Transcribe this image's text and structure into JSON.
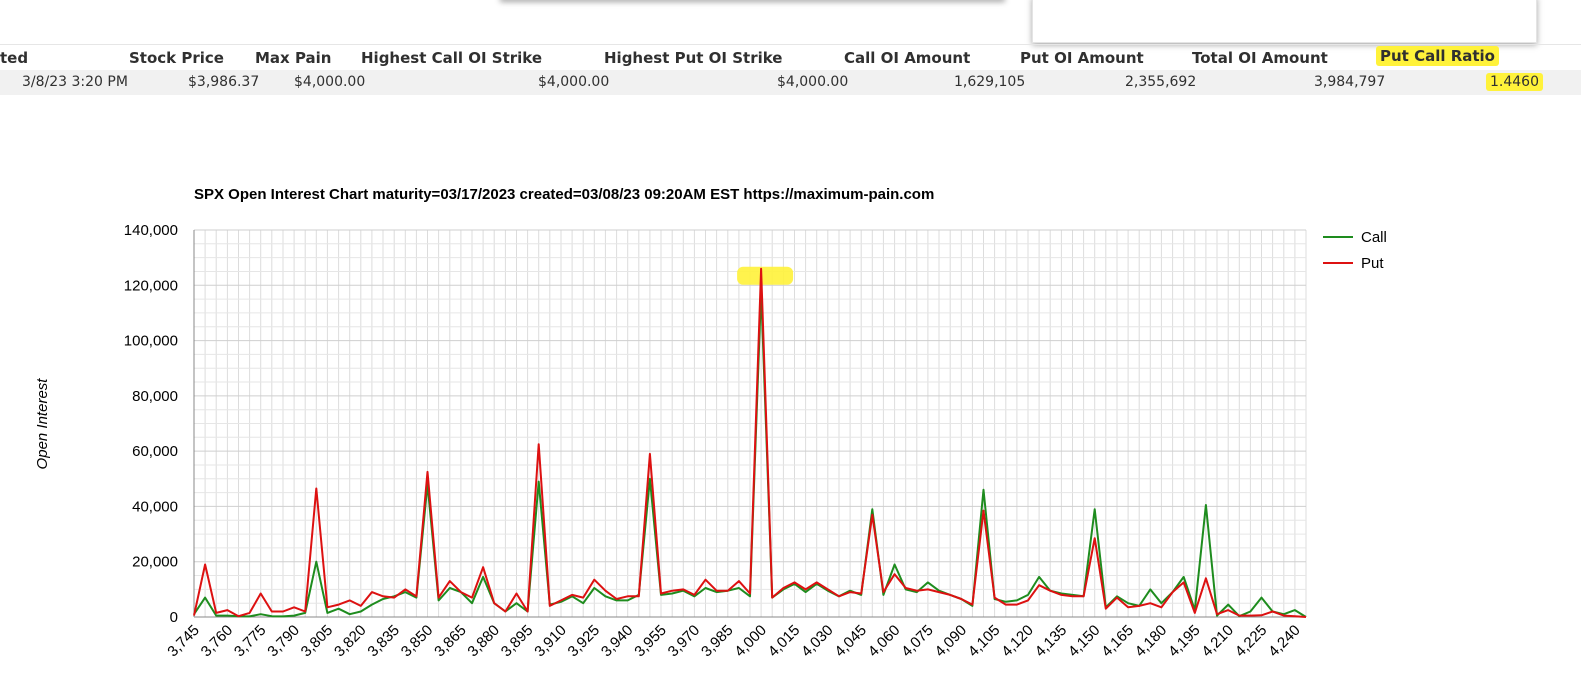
{
  "summary": {
    "headers": [
      "ted",
      "Stock Price",
      "Max Pain",
      "Highest Call OI Strike",
      "Highest Put OI Strike",
      "Call OI Amount",
      "Put OI Amount",
      "Total OI Amount",
      "Put Call Ratio"
    ],
    "values": [
      "3/8/23 3:20 PM",
      "$3,986.37",
      "$4,000.00",
      "$4,000.00",
      "$4,000.00",
      "1,629,105",
      "2,355,692",
      "3,984,797",
      "1.4460"
    ]
  },
  "highlight_color": "#fff23a",
  "chart_data": {
    "type": "line",
    "title": "SPX Open Interest Chart maturity=03/17/2023 created=03/08/23 09:20AM EST https://maximum-pain.com",
    "xlabel": "",
    "ylabel": "Open Interest",
    "ylim": [
      0,
      140000
    ],
    "yticks": [
      "0",
      "20,000",
      "40,000",
      "60,000",
      "80,000",
      "100,000",
      "120,000",
      "140,000"
    ],
    "x_tick_labels": [
      "3,745",
      "3,760",
      "3,775",
      "3,790",
      "3,805",
      "3,820",
      "3,835",
      "3,850",
      "3,865",
      "3,880",
      "3,895",
      "3,910",
      "3,925",
      "3,940",
      "3,955",
      "3,970",
      "3,985",
      "4,000",
      "4,015",
      "4,030",
      "4,045",
      "4,060",
      "4,075",
      "4,090",
      "4,105",
      "4,120",
      "4,135",
      "4,150",
      "4,165",
      "4,180",
      "4,195",
      "4,210",
      "4,225",
      "4,240"
    ],
    "x": [
      3745,
      3750,
      3755,
      3760,
      3765,
      3770,
      3775,
      3780,
      3785,
      3790,
      3795,
      3800,
      3805,
      3810,
      3815,
      3820,
      3825,
      3830,
      3835,
      3840,
      3845,
      3850,
      3855,
      3860,
      3865,
      3870,
      3875,
      3880,
      3885,
      3890,
      3895,
      3900,
      3905,
      3910,
      3915,
      3920,
      3925,
      3930,
      3935,
      3940,
      3945,
      3950,
      3955,
      3960,
      3965,
      3970,
      3975,
      3980,
      3985,
      3990,
      3995,
      4000,
      4005,
      4010,
      4015,
      4020,
      4025,
      4030,
      4035,
      4040,
      4045,
      4050,
      4055,
      4060,
      4065,
      4070,
      4075,
      4080,
      4085,
      4090,
      4095,
      4100,
      4105,
      4110,
      4115,
      4120,
      4125,
      4130,
      4135,
      4140,
      4145,
      4150,
      4155,
      4160,
      4165,
      4170,
      4175,
      4180,
      4185,
      4190,
      4195,
      4200,
      4205,
      4210,
      4215,
      4220,
      4225,
      4230,
      4235,
      4240,
      4245
    ],
    "series": [
      {
        "name": "Call",
        "color": "#1e8c1e",
        "values": [
          1000,
          7000,
          500,
          500,
          300,
          200,
          1000,
          300,
          200,
          500,
          1500,
          20000,
          1500,
          3000,
          1000,
          2000,
          4500,
          6500,
          7500,
          9000,
          7000,
          48000,
          6000,
          10500,
          9000,
          5000,
          14500,
          5000,
          2000,
          5000,
          2000,
          49000,
          4500,
          5500,
          7500,
          5000,
          10500,
          7500,
          6000,
          6000,
          8000,
          50000,
          8000,
          8500,
          9500,
          7500,
          10500,
          9000,
          9500,
          10500,
          7500,
          118000,
          7000,
          10000,
          12000,
          9000,
          12000,
          9500,
          7500,
          9500,
          8000,
          39000,
          8000,
          19000,
          10000,
          9000,
          12500,
          9500,
          8000,
          6500,
          4000,
          46000,
          6500,
          5500,
          6000,
          8000,
          14500,
          9500,
          8500,
          8000,
          7500,
          39000,
          3500,
          7500,
          5000,
          4000,
          10000,
          5000,
          9000,
          14500,
          2500,
          40500,
          500,
          4500,
          300,
          2000,
          7000,
          2000,
          1000,
          2500,
          0
        ]
      },
      {
        "name": "Put",
        "color": "#dd1111",
        "values": [
          500,
          19000,
          1500,
          2500,
          300,
          1500,
          8500,
          2000,
          2000,
          3500,
          2000,
          46500,
          3500,
          4500,
          6000,
          4000,
          9000,
          7500,
          7000,
          10000,
          7500,
          52500,
          7000,
          13000,
          9000,
          7000,
          18000,
          5000,
          2000,
          8500,
          2000,
          62500,
          4000,
          6000,
          8000,
          7000,
          13500,
          9500,
          6500,
          7500,
          7500,
          59000,
          8500,
          9500,
          10000,
          8000,
          13500,
          9500,
          9500,
          13000,
          8500,
          126000,
          7000,
          10500,
          12500,
          10000,
          12500,
          10000,
          7500,
          9000,
          8500,
          37000,
          9000,
          15500,
          10500,
          9500,
          10000,
          9000,
          8000,
          6500,
          4500,
          38500,
          7000,
          4500,
          4500,
          6000,
          11500,
          9500,
          8000,
          7500,
          7500,
          28500,
          3000,
          7000,
          3500,
          4000,
          5000,
          3500,
          9000,
          12500,
          1500,
          14000,
          1000,
          2500,
          500,
          500,
          600,
          2000,
          500,
          300,
          0
        ]
      }
    ],
    "legend_position": "top-right",
    "grid": true
  }
}
